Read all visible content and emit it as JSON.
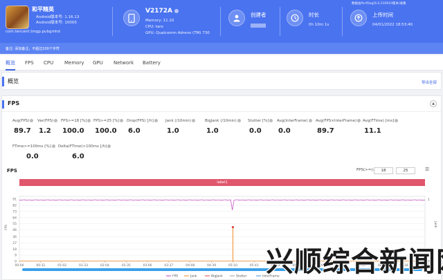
{
  "header": {
    "app": {
      "name": "和平精英",
      "android_version": "Android版本号: 1.16.13",
      "android_code": "Android版本号: 10000",
      "package": "com.tencent.tmgp.pubgmhd"
    },
    "device": {
      "name": "V2172A",
      "memory": "Memory: 11.10",
      "cpu": "CPU: taro",
      "gpu": "GPU: Qualcomm Adreno (TM) 730"
    },
    "creator": {
      "title": "创建者"
    },
    "duration": {
      "title": "时长",
      "value": "0h 10m 1s"
    },
    "upload": {
      "title": "上传时间",
      "value": "04/01/2022 18:53:40"
    },
    "tool_version": "数据由PerfDog(6.0.210910版本)收集"
  },
  "note": "备注: 添加备注，不超过200个字符",
  "tabs": [
    "概览",
    "FPS",
    "CPU",
    "Memory",
    "GPU",
    "Network",
    "Battery"
  ],
  "active_tab": "概览",
  "overview": {
    "title": "概览",
    "export_label": "导出全部"
  },
  "fps_card": {
    "title": "FPS",
    "collapse_icon": "chevron-up"
  },
  "stats_row1": [
    {
      "label": "Avg(FPS)",
      "value": "89.7"
    },
    {
      "label": "Var(FPS)",
      "value": "1.2"
    },
    {
      "label": "FPS>=18 [%]",
      "value": "100.0"
    },
    {
      "label": "FPS>=25 [%]",
      "value": "100.0"
    },
    {
      "label": "Drop(FPS) [/h]",
      "value": "6.0"
    },
    {
      "label": "Jank (/10min)",
      "value": "1.0"
    },
    {
      "label": "BigJank (/10min)",
      "value": "1.0"
    },
    {
      "label": "Stutter [%]",
      "value": "0.0"
    },
    {
      "label": "Avg(InterFrame)",
      "value": "0.0"
    },
    {
      "label": "Avg(FPS×InterFrame)",
      "value": "89.7"
    },
    {
      "label": "Avg(FTime) [ms]",
      "value": "11.1"
    }
  ],
  "stats_row2": [
    {
      "label": "FTime>=100ms [%]",
      "value": "0.0"
    },
    {
      "label": "Delta(FTime)>100ms [/h]",
      "value": "6.0"
    }
  ],
  "chart_header": {
    "title": "FPS",
    "filter_label": "FPS(>=):",
    "filter_values": [
      "18",
      "25"
    ],
    "label_bar": "label1"
  },
  "chart_data": {
    "type": "line",
    "ylabel": "FPS",
    "y2label": "Jank",
    "yticks": [
      0,
      9,
      18,
      27,
      36,
      46,
      55,
      64,
      73,
      82,
      91
    ],
    "y2ticks": [
      0,
      1
    ],
    "xticks": [
      "00:00",
      "00:31",
      "01:02",
      "01:33",
      "02:04",
      "02:35",
      "03:06",
      "03:37",
      "04:08",
      "04:39",
      "05:10",
      "05:41",
      "06:12",
      "06:43",
      "07:14",
      "07:45",
      "08:16",
      "08:47",
      "09:18",
      "09:49"
    ],
    "series": [
      {
        "name": "FPS",
        "color": "#c040c0",
        "baseline": 89.7,
        "dip_at": "05:10",
        "dip_value": 75
      },
      {
        "name": "Jank",
        "color": "#f08c28",
        "baseline": 0,
        "spike_at": "05:10",
        "spike_value": 1
      },
      {
        "name": "BigJank",
        "color": "#e04040",
        "baseline": 0,
        "spike_at": "05:10",
        "spike_value": 1
      },
      {
        "name": "Stutter",
        "color": "#999999",
        "baseline": 0
      },
      {
        "name": "InterFrame",
        "color": "#4a90e2",
        "baseline": 0
      }
    ],
    "ylim": [
      0,
      91
    ]
  },
  "watermark": "兴顺综合新闻网"
}
